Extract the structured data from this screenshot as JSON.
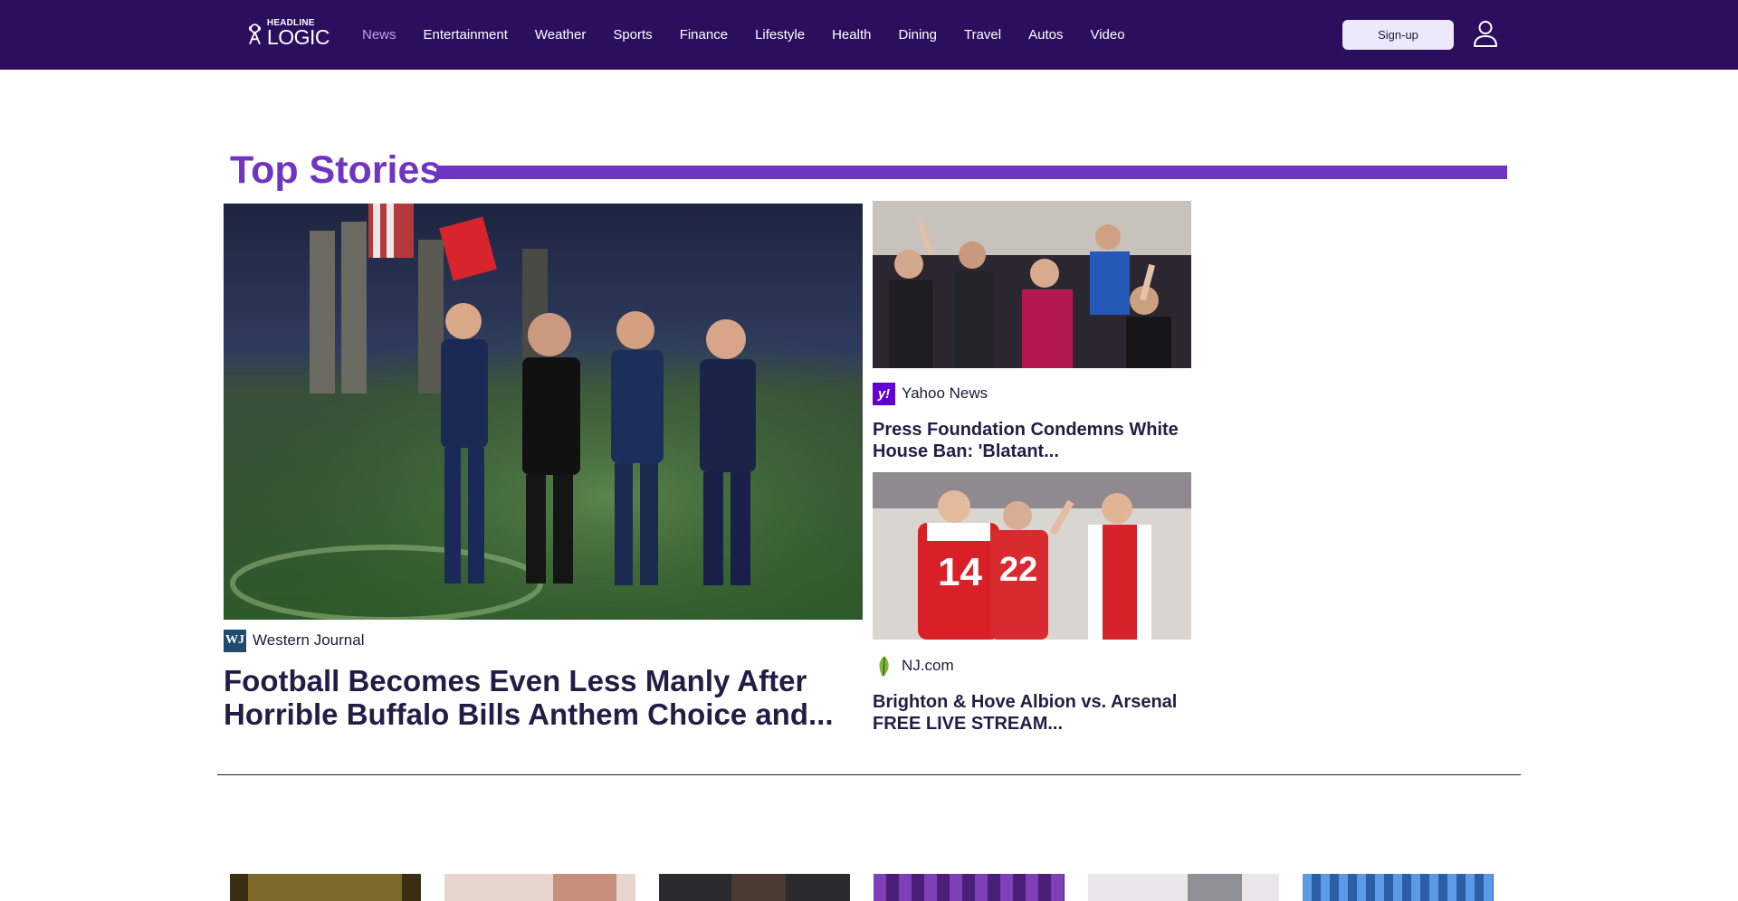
{
  "header": {
    "logo": {
      "line1": "HEADLINE",
      "line2": "LOGIC"
    },
    "nav": [
      {
        "label": "News",
        "active": true
      },
      {
        "label": "Entertainment",
        "active": false
      },
      {
        "label": "Weather",
        "active": false
      },
      {
        "label": "Sports",
        "active": false
      },
      {
        "label": "Finance",
        "active": false
      },
      {
        "label": "Lifestyle",
        "active": false
      },
      {
        "label": "Health",
        "active": false
      },
      {
        "label": "Dining",
        "active": false
      },
      {
        "label": "Travel",
        "active": false
      },
      {
        "label": "Autos",
        "active": false
      },
      {
        "label": "Video",
        "active": false
      }
    ],
    "signup_label": "Sign-up",
    "user_icon": "user-icon"
  },
  "top_stories": {
    "title": "Top Stories",
    "main": {
      "source": "Western Journal",
      "source_logo_text": "WJ",
      "headline": "Football Becomes Even Less Manly After Horrible Buffalo Bills Anthem Choice and..."
    },
    "side": [
      {
        "source": "Yahoo News",
        "source_logo_text": "y!",
        "headline": "Press Foundation Condemns White House Ban: 'Blatant..."
      },
      {
        "source": "NJ.com",
        "source_logo_text": "",
        "headline": "Brighton & Hove Albion vs. Arsenal FREE LIVE STREAM..."
      }
    ]
  },
  "colors": {
    "header_bg": "#2b0f5e",
    "accent": "#6f35c2",
    "nav_active": "#b9a3ef",
    "signup_bg": "#ebe9fb"
  }
}
